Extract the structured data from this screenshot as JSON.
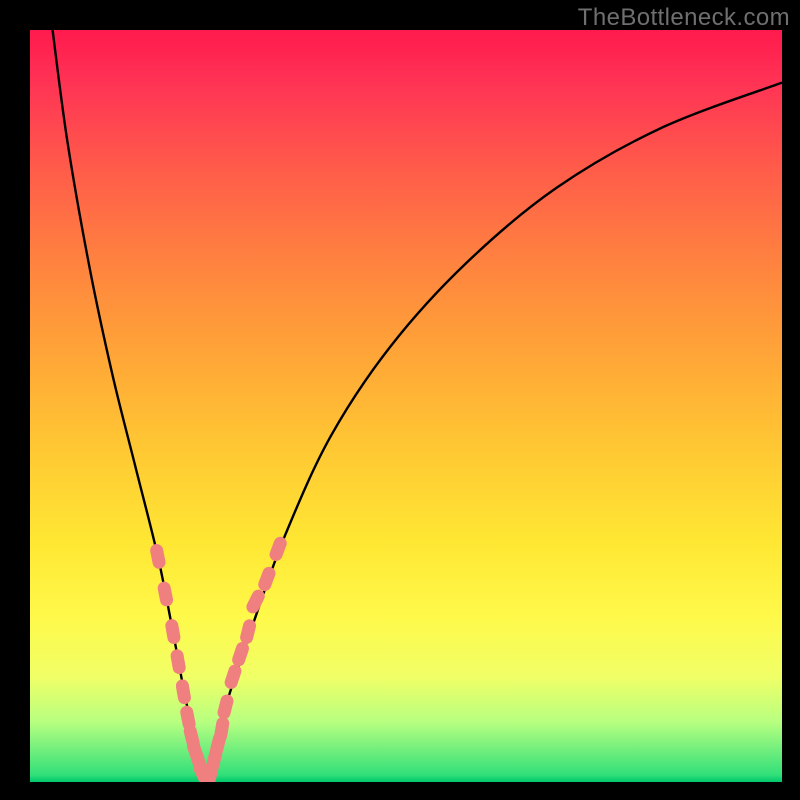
{
  "watermark": "TheBottleneck.com",
  "chart_data": {
    "type": "line",
    "title": "",
    "xlabel": "",
    "ylabel": "",
    "xlim": [
      0,
      100
    ],
    "ylim": [
      0,
      100
    ],
    "description": "V-shaped bottleneck curve over rainbow gradient background (red=high, green=low). Two pale-red dotted overlay segments near the valley mark a highlighted range.",
    "series": [
      {
        "name": "bottleneck-curve",
        "x": [
          3,
          5,
          8,
          11,
          14,
          17,
          19,
          20.5,
          22,
          23.5,
          25,
          26,
          30,
          34,
          40,
          48,
          58,
          70,
          84,
          100
        ],
        "y": [
          100,
          85,
          68,
          54,
          42,
          30,
          20,
          12,
          5,
          0,
          5,
          10,
          22,
          33,
          46,
          58,
          69,
          79,
          87,
          93
        ]
      }
    ],
    "highlight_segments": [
      {
        "name": "left-dots",
        "x": [
          17,
          18,
          19,
          19.7,
          20.4,
          21,
          21.5,
          22,
          22.5,
          23,
          23.5
        ],
        "y": [
          30,
          25,
          20,
          16,
          12,
          8.5,
          6,
          4,
          2.5,
          1,
          0
        ]
      },
      {
        "name": "right-dots",
        "x": [
          24,
          24.5,
          25,
          25.5,
          26,
          27,
          28,
          29,
          30,
          31.5,
          33
        ],
        "y": [
          1,
          3,
          5,
          7,
          10,
          14,
          17,
          20,
          24,
          27,
          31
        ]
      }
    ],
    "colors": {
      "curve": "#000000",
      "dots": "#f08080",
      "gradient_top": "#ff1a4d",
      "gradient_bottom": "#00c86a"
    }
  }
}
